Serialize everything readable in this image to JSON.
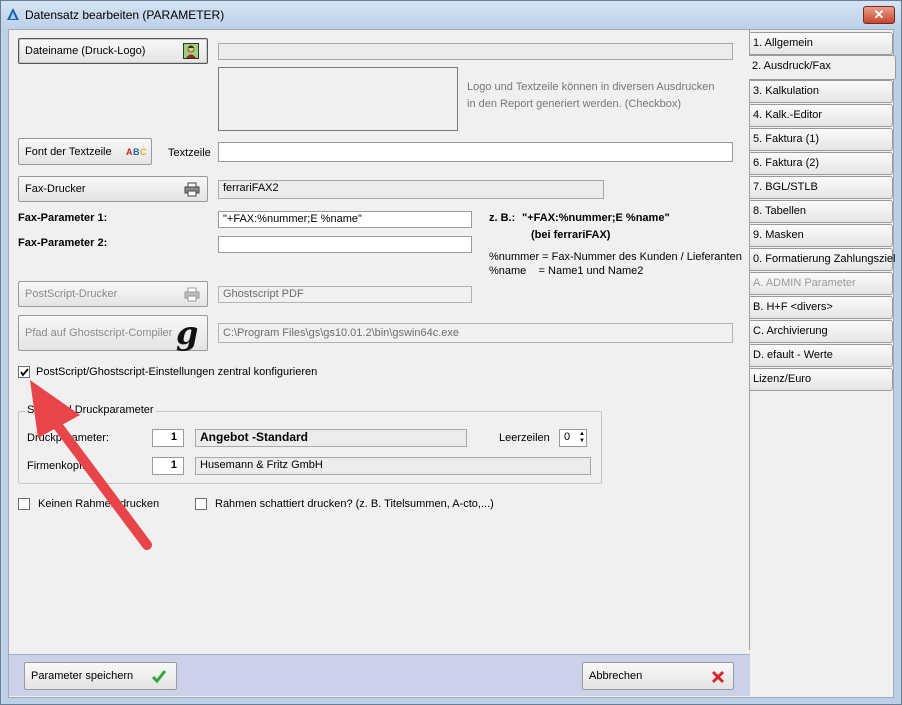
{
  "window": {
    "title": "Datensatz bearbeiten  (PARAMETER)",
    "close_glyph": "✕"
  },
  "logo": {
    "button_label": "Dateiname (Druck-Logo)",
    "filename_value": "",
    "hint_line1": "Logo und Textzeile können in diversen Ausdrucken",
    "hint_line2": "in den Report generiert werden. (Checkbox)"
  },
  "font": {
    "button_label": "Font der Textzeile",
    "abc_glyph": "ABC",
    "textzeile_label": "Textzeile",
    "textzeile_value": ""
  },
  "fax": {
    "button_label": "Fax-Drucker",
    "printer_value": "ferrariFAX2",
    "param1_label": "Fax-Parameter 1:",
    "param1_value": "\"+FAX:%nummer;E %name\"",
    "param2_label": "Fax-Parameter 2:",
    "param2_value": "",
    "example_prefix": "z. B.:",
    "example_value": "\"+FAX:%nummer;E %name\"",
    "example_sub": "(bei ferrariFAX)",
    "legend_line1": "%nummer = Fax-Nummer des Kunden / Lieferanten",
    "legend_line2": "%name    = Name1 und Name2"
  },
  "postscript": {
    "button_label": "PostScript-Drucker",
    "printer_value": "Ghostscript PDF",
    "path_button_label": "Pfad auf Ghostscript-Compiler",
    "path_value": "C:\\Program Files\\gs\\gs10.01.2\\bin\\gswin64c.exe",
    "gs_glyph": "g",
    "central_config_label": "PostScript/Ghostscript-Einstellungen zentral konfigurieren",
    "central_config_checked": true
  },
  "standard": {
    "group_label": "Standard Druckparameter",
    "druckparameter_label": "Druckparameter:",
    "druckparameter_num": "1",
    "druckparameter_name": "Angebot -Standard",
    "leerzeilen_label": "Leerzeilen",
    "leerzeilen_value": "0",
    "firmenkopf_label": "Firmenkopf:",
    "firmenkopf_num": "1",
    "firmenkopf_name": "Husemann & Fritz GmbH"
  },
  "options": {
    "keinen_rahmen_label": "Keinen Rahmen drucken",
    "rahmen_schattiert_label": "Rahmen schattiert drucken? (z. B. Titelsummen, A-cto,...)"
  },
  "tabs": [
    {
      "label": "1. Allgemein",
      "state": "normal"
    },
    {
      "label": "2. Ausdruck/Fax",
      "state": "active"
    },
    {
      "label": "3. Kalkulation",
      "state": "normal"
    },
    {
      "label": "4. Kalk.-Editor",
      "state": "normal"
    },
    {
      "label": "5. Faktura (1)",
      "state": "normal"
    },
    {
      "label": "6. Faktura (2)",
      "state": "normal"
    },
    {
      "label": "7. BGL/STLB",
      "state": "normal"
    },
    {
      "label": "8. Tabellen",
      "state": "normal"
    },
    {
      "label": "9. Masken",
      "state": "normal"
    },
    {
      "label": "0. Formatierung Zahlungsziel",
      "state": "normal"
    },
    {
      "label": "A. ADMIN Parameter",
      "state": "disabled"
    },
    {
      "label": "B. H+F <divers>",
      "state": "normal"
    },
    {
      "label": "C. Archivierung",
      "state": "normal"
    },
    {
      "label": "D. efault - Werte",
      "state": "normal"
    },
    {
      "label": "Lizenz/Euro",
      "state": "normal"
    }
  ],
  "footer": {
    "save_label": "Parameter speichern",
    "cancel_label": "Abbrechen"
  },
  "colors": {
    "accent_arrow": "#e8454a",
    "save_check": "#2fa83a",
    "cancel_x": "#d6282c",
    "footer_bg": "#ccd0e8"
  }
}
